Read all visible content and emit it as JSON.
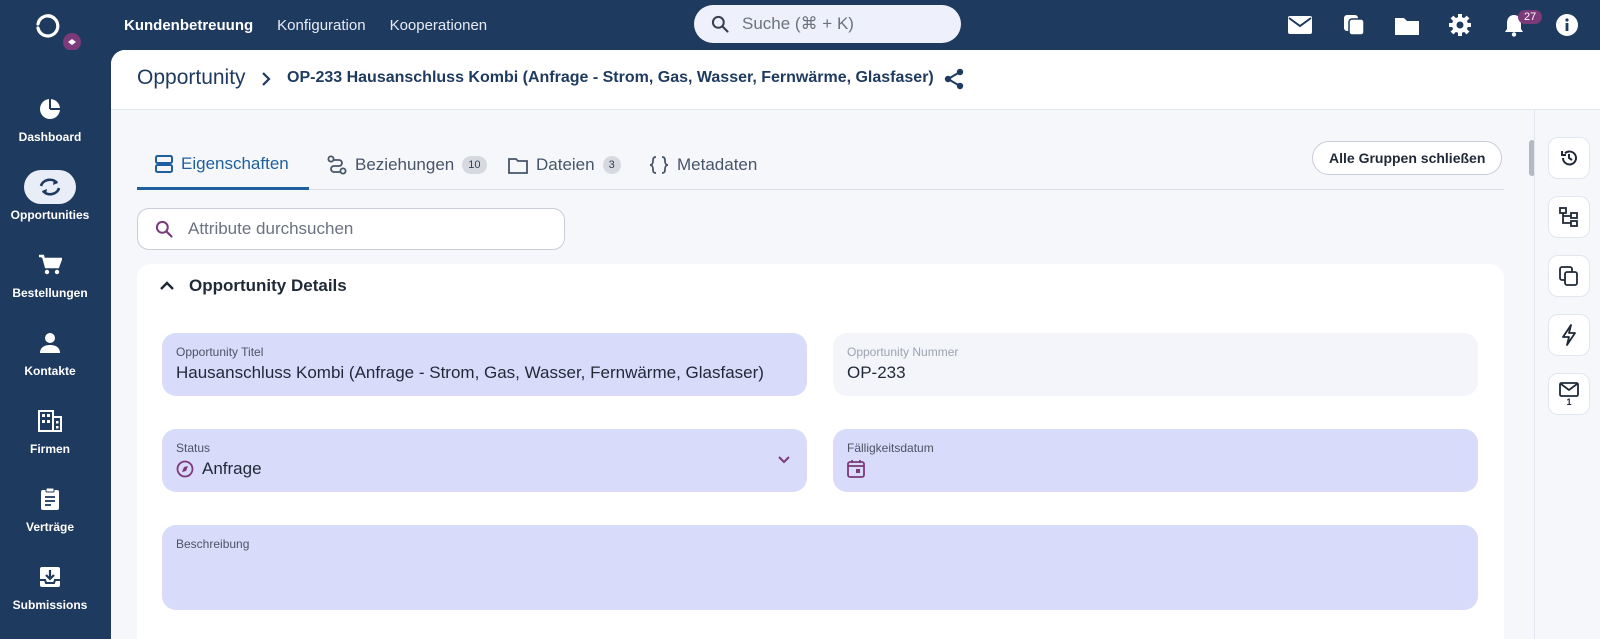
{
  "topnav": {
    "items": [
      {
        "label": "Kundenbetreuung",
        "active": true
      },
      {
        "label": "Konfiguration",
        "active": false
      },
      {
        "label": "Kooperationen",
        "active": false
      }
    ],
    "search_placeholder": "Suche (⌘ + K)",
    "notification_count": "27",
    "icons": [
      "mail-icon",
      "copy-icon",
      "folder-icon",
      "gear-icon",
      "bell-icon",
      "info-icon"
    ]
  },
  "sidebar": {
    "items": [
      {
        "label": "Dashboard",
        "icon": "pie-chart-icon",
        "active": false
      },
      {
        "label": "Opportunities",
        "icon": "sync-icon",
        "active": true
      },
      {
        "label": "Bestellungen",
        "icon": "cart-icon",
        "active": false
      },
      {
        "label": "Kontakte",
        "icon": "person-icon",
        "active": false
      },
      {
        "label": "Firmen",
        "icon": "building-icon",
        "active": false
      },
      {
        "label": "Verträge",
        "icon": "clipboard-icon",
        "active": false
      },
      {
        "label": "Submissions",
        "icon": "inbox-download-icon",
        "active": false
      }
    ]
  },
  "breadcrumb": {
    "root": "Opportunity",
    "current": "OP-233 Hausanschluss Kombi (Anfrage - Strom, Gas, Wasser, Fernwärme, Glasfaser)"
  },
  "tabs": [
    {
      "label": "Eigenschaften",
      "count": "",
      "active": true
    },
    {
      "label": "Beziehungen",
      "count": "10",
      "active": false
    },
    {
      "label": "Dateien",
      "count": "3",
      "active": false
    },
    {
      "label": "Metadaten",
      "count": "",
      "active": false
    }
  ],
  "close_groups_label": "Alle Gruppen schließen",
  "attribute_search_placeholder": "Attribute durchsuchen",
  "group": {
    "title": "Opportunity Details",
    "fields": {
      "title": {
        "label": "Opportunity Titel",
        "value": "Hausanschluss Kombi (Anfrage - Strom, Gas, Wasser, Fernwärme, Glasfaser)"
      },
      "number": {
        "label": "Opportunity Nummer",
        "value": "OP-233"
      },
      "status": {
        "label": "Status",
        "value": "Anfrage"
      },
      "due_date": {
        "label": "Fälligkeitsdatum",
        "value": ""
      },
      "description": {
        "label": "Beschreibung",
        "value": ""
      }
    }
  },
  "right_rail": {
    "mail_count": "1"
  },
  "colors": {
    "nav_bg": "#1f3a5f",
    "accent": "#1f5f9e",
    "field_bg": "#d8dbfa",
    "status_icon": "#7c3a7a"
  }
}
